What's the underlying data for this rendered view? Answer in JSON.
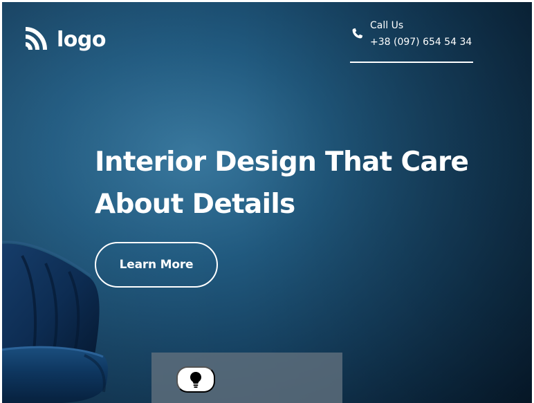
{
  "brand": {
    "logo_text": "logo",
    "logo_icon": "wifi-arc-logo-icon"
  },
  "contact": {
    "label": "Call Us",
    "phone": "+38 (097) 654 54 34",
    "phone_icon": "phone-icon"
  },
  "hero": {
    "headline": "Interior Design That Care About Details",
    "cta_label": "Learn More"
  },
  "floating_action": {
    "icon": "lightbulb-icon"
  },
  "colors": {
    "hero_blue": "#225d83",
    "hero_dark_blue": "#0b2339",
    "text_white": "#ffffff",
    "panel_gray": "#5f6f7c"
  }
}
